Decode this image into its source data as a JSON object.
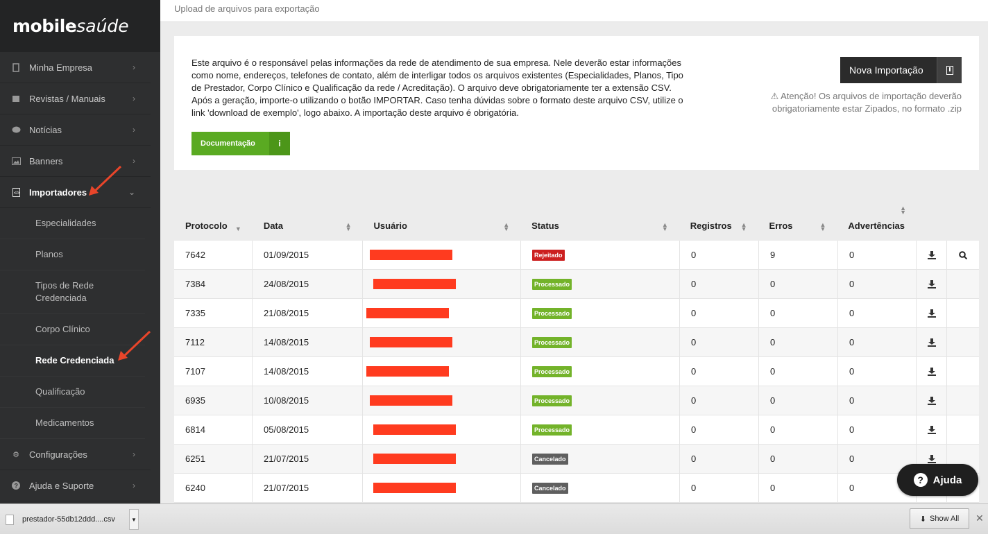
{
  "brand": {
    "bold": "mobile",
    "italic": "saúde"
  },
  "sidebar": {
    "items": [
      {
        "label": "Minha Empresa",
        "icon": "building-icon"
      },
      {
        "label": "Revistas / Manuais",
        "icon": "book-icon"
      },
      {
        "label": "Notícias",
        "icon": "comment-icon"
      },
      {
        "label": "Banners",
        "icon": "image-icon"
      },
      {
        "label": "Importadores",
        "icon": "file-code-icon"
      }
    ],
    "sub_items": [
      {
        "label": "Especialidades"
      },
      {
        "label": "Planos"
      },
      {
        "label": "Tipos de Rede Credenciada"
      },
      {
        "label": "Corpo Clínico"
      },
      {
        "label": "Rede Credenciada"
      },
      {
        "label": "Qualificação"
      },
      {
        "label": "Medicamentos"
      }
    ],
    "bottom_items": [
      {
        "label": "Configurações",
        "icon": "gear-icon"
      },
      {
        "label": "Ajuda e Suporte",
        "icon": "question-icon"
      }
    ]
  },
  "header": {
    "subtitle": "Upload de arquivos para exportação"
  },
  "info": {
    "text": "Este arquivo é o responsável pelas informações da rede de atendimento de sua empresa. Nele deverão estar informações como nome, endereços, telefones de contato, além de interligar todos os arquivos existentes (Especialidades, Planos, Tipo de Prestador, Corpo Clínico e Qualificação da rede / Acreditação). O arquivo deve obrigatoriamente ter a extensão CSV. Após a geração, importe-o utilizando o botão IMPORTAR. Caso tenha dúvidas sobre o formato deste arquivo CSV, utilize o link 'download de exemplo', logo abaixo. A importação deste arquivo é obrigatória.",
    "doc_button": "Documentação",
    "import_button": "Nova Importação",
    "warning": "Atenção! Os arquivos de importação deverão obrigatoriamente estar Zipados, no formato .zip"
  },
  "table": {
    "columns": [
      "Protocolo",
      "Data",
      "Usuário",
      "Status",
      "Registros",
      "Erros",
      "Advertências"
    ],
    "rows": [
      {
        "protocolo": "7642",
        "data": "01/09/2015",
        "status": "Rejeitado",
        "status_type": "rej",
        "registros": "0",
        "erros": "9",
        "advertencias": "0",
        "has_search": true
      },
      {
        "protocolo": "7384",
        "data": "24/08/2015",
        "status": "Processado",
        "status_type": "proc",
        "registros": "0",
        "erros": "0",
        "advertencias": "0",
        "has_search": false
      },
      {
        "protocolo": "7335",
        "data": "21/08/2015",
        "status": "Processado",
        "status_type": "proc",
        "registros": "0",
        "erros": "0",
        "advertencias": "0",
        "has_search": false
      },
      {
        "protocolo": "7112",
        "data": "14/08/2015",
        "status": "Processado",
        "status_type": "proc",
        "registros": "0",
        "erros": "0",
        "advertencias": "0",
        "has_search": false
      },
      {
        "protocolo": "7107",
        "data": "14/08/2015",
        "status": "Processado",
        "status_type": "proc",
        "registros": "0",
        "erros": "0",
        "advertencias": "0",
        "has_search": false
      },
      {
        "protocolo": "6935",
        "data": "10/08/2015",
        "status": "Processado",
        "status_type": "proc",
        "registros": "0",
        "erros": "0",
        "advertencias": "0",
        "has_search": false
      },
      {
        "protocolo": "6814",
        "data": "05/08/2015",
        "status": "Processado",
        "status_type": "proc",
        "registros": "0",
        "erros": "0",
        "advertencias": "0",
        "has_search": false
      },
      {
        "protocolo": "6251",
        "data": "21/07/2015",
        "status": "Cancelado",
        "status_type": "canc",
        "registros": "0",
        "erros": "0",
        "advertencias": "0",
        "has_search": false
      },
      {
        "protocolo": "6240",
        "data": "21/07/2015",
        "status": "Cancelado",
        "status_type": "canc",
        "registros": "0",
        "erros": "0",
        "advertencias": "0",
        "has_search": false
      }
    ]
  },
  "help": {
    "label": "Ajuda"
  },
  "download_bar": {
    "file": "prestador-55db12ddd....csv",
    "show_all": "Show All"
  },
  "colors": {
    "accent_green": "#5aaa22",
    "redaction": "#ff3b1f",
    "rejected": "#cc1f1f",
    "processed": "#73b32a",
    "cancelled": "#5f5f5f",
    "arrow": "#e8452a"
  }
}
